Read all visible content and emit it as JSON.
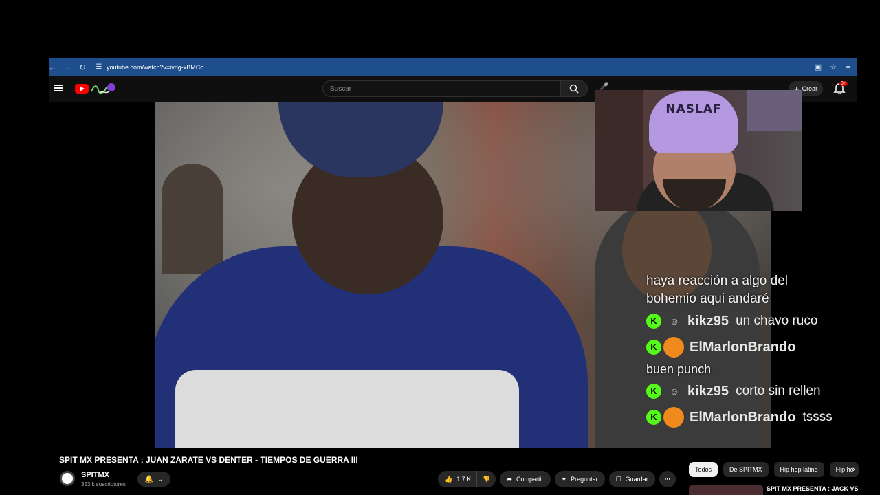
{
  "browser": {
    "url": "youtube.com/watch?v=ivrlg-xBMCo"
  },
  "header": {
    "search_placeholder": "Buscar",
    "create_label": "Crear",
    "notification_count": "9+"
  },
  "chat": {
    "messages": [
      {
        "type": "text",
        "text": "haya reacción a algo del"
      },
      {
        "type": "text",
        "text": "bohemio aqui andaré"
      },
      {
        "type": "user",
        "username": "kikz95",
        "text": "un chavo ruco",
        "avatar": "user-icon"
      },
      {
        "type": "user",
        "username": "ElMarlonBrando",
        "text": "",
        "avatar": "orange"
      },
      {
        "type": "text",
        "text": "buen punch"
      },
      {
        "type": "user",
        "username": "kikz95",
        "text": "corto sin rellen",
        "avatar": "user-icon"
      },
      {
        "type": "user",
        "username": "ElMarlonBrando",
        "text": "tssss",
        "avatar": "orange"
      }
    ],
    "badge_color": "#53fc18"
  },
  "webcam": {
    "hat_text": "NASLAF"
  },
  "video": {
    "title": "SPIT MX PRESENTA : JUAN ZARATE VS DENTER - TIEMPOS DE GUERRA III",
    "channel_name": "SPITMX",
    "subscribers": "353 k suscriptores",
    "like_count": "1.7 K",
    "share_label": "Compartir",
    "ask_label": "Preguntar",
    "save_label": "Guardar"
  },
  "chips": [
    "Todos",
    "De SPITMX",
    "Hip hop latino",
    "Hip ho"
  ],
  "recommendation": {
    "title": "SPIT MX PRESENTA : JACK VS"
  },
  "colors": {
    "browser_bar": "#1e4f8c",
    "yt_red": "#ff0000",
    "background": "#0f0f0f"
  }
}
